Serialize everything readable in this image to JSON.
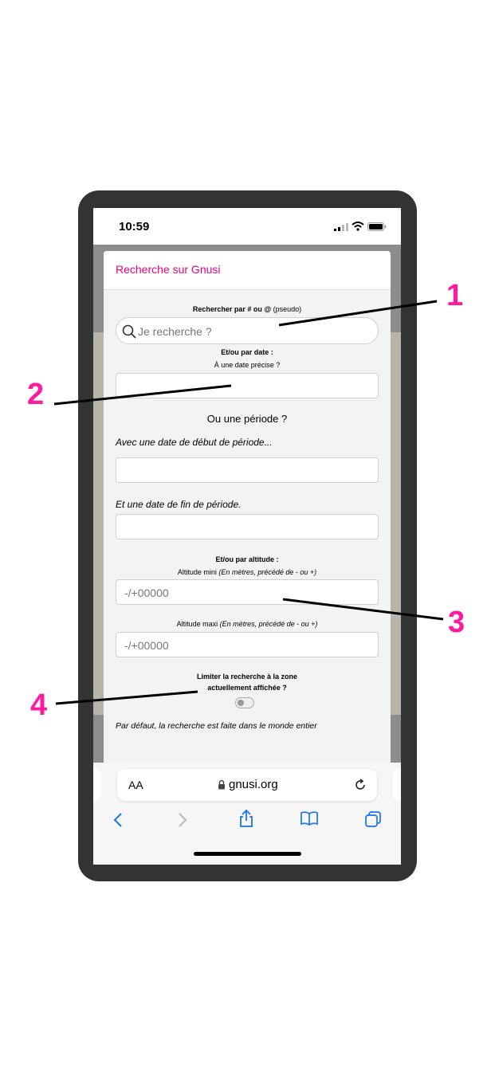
{
  "status_bar": {
    "time": "10:59"
  },
  "modal": {
    "title": "Recherche sur Gnusi",
    "search_label_bold": "Rechercher par # ou @",
    "search_label_extra": " (pseudo)",
    "search_placeholder": "Je recherche ?",
    "date_heading": "Et/ou par date :",
    "date_precise_label": "À une date précise ?",
    "period_heading": "Ou une période ?",
    "period_start_label": "Avec une date de début de période...",
    "period_end_label": "Et une date de fin de période.",
    "altitude_heading": "Et/ou par altitude :",
    "alt_min_label": "Altitude mini",
    "alt_min_note": " (En mètres, précédé de - ou +)",
    "alt_min_placeholder": "-/+00000",
    "alt_max_label": "Altitude maxi",
    "alt_max_note": " (En mètres, précédé de - ou +)",
    "alt_max_placeholder": "-/+00000",
    "limit_line1": "Limiter la recherche à la zone",
    "limit_line2": "actuellement affichée ?",
    "limit_toggle_on": false,
    "default_note": "Par défaut, la recherche est faite dans le monde entier"
  },
  "browser": {
    "text_size_label": "AA",
    "url": "gnusi.org"
  },
  "callouts": [
    "1",
    "2",
    "3",
    "4"
  ],
  "colors": {
    "accent": "#e6007e",
    "callout": "#ff1aa0",
    "ios_blue": "#1a73e8"
  },
  "icons": [
    "signal-icon",
    "wifi-icon",
    "battery-icon",
    "search-icon",
    "lock-icon",
    "reload-icon",
    "back-icon",
    "forward-icon",
    "share-icon",
    "bookmarks-icon",
    "tabs-icon"
  ]
}
